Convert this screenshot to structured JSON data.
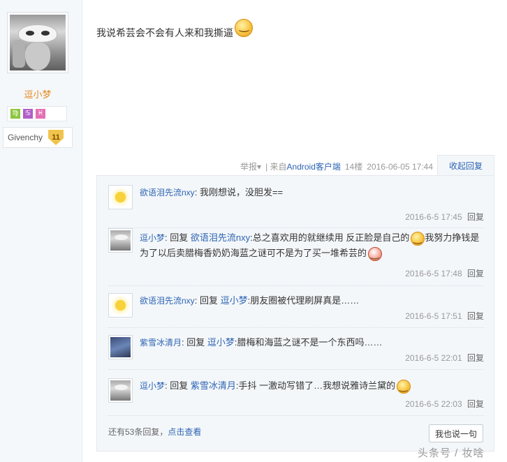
{
  "author": {
    "name": "逗小梦",
    "zodiac": [
      "♍",
      "♋",
      "♓"
    ],
    "badge_text": "Givenchy",
    "badge_level": "11"
  },
  "post": {
    "content": "我说希芸会不会有人来和我撕逼",
    "footer": {
      "report": "举报",
      "source_prefix": "| 来自",
      "source_link": "Android客户端",
      "floor": "14楼",
      "time": "2016-06-05 17:44"
    },
    "collapse_label": "收起回复"
  },
  "replies": [
    {
      "user": "欲语泪先流nxy",
      "reply_word": "",
      "target": "",
      "text_a": "我刚想说，没胆发==",
      "text_b": "",
      "time": "2016-6-5 17:45",
      "reply_label": "回复"
    },
    {
      "user": "逗小梦",
      "reply_word": "回复",
      "target": "欲语泪先流nxy",
      "text_a": ":总之喜欢用的就继续用 反正脸是自己的",
      "text_b": "我努力挣钱是为了以后卖腊梅香奶奶海蓝之谜可不是为了买一堆希芸的",
      "time": "2016-6-5 17:48",
      "reply_label": "回复"
    },
    {
      "user": "欲语泪先流nxy",
      "reply_word": "回复",
      "target": "逗小梦",
      "text_a": ":朋友圈被代理刷屏真是……",
      "text_b": "",
      "time": "2016-6-5 17:51",
      "reply_label": "回复"
    },
    {
      "user": "紫雪冰清月",
      "reply_word": "回复",
      "target": "逗小梦",
      "text_a": ":腊梅和海蓝之谜不是一个东西吗……",
      "text_b": "",
      "time": "2016-6-5 22:01",
      "reply_label": "回复"
    },
    {
      "user": "逗小梦",
      "reply_word": "回复",
      "target": "紫雪冰清月",
      "text_a": ":手抖 一激动写错了…我想说雅诗兰黛的",
      "text_b": "",
      "time": "2016-6-5 22:03",
      "reply_label": "回复"
    }
  ],
  "more": {
    "prefix": "还有53条回复，",
    "link": "点击查看"
  },
  "say_button": "我也说一句",
  "watermark": "头条号 / 妆啥"
}
